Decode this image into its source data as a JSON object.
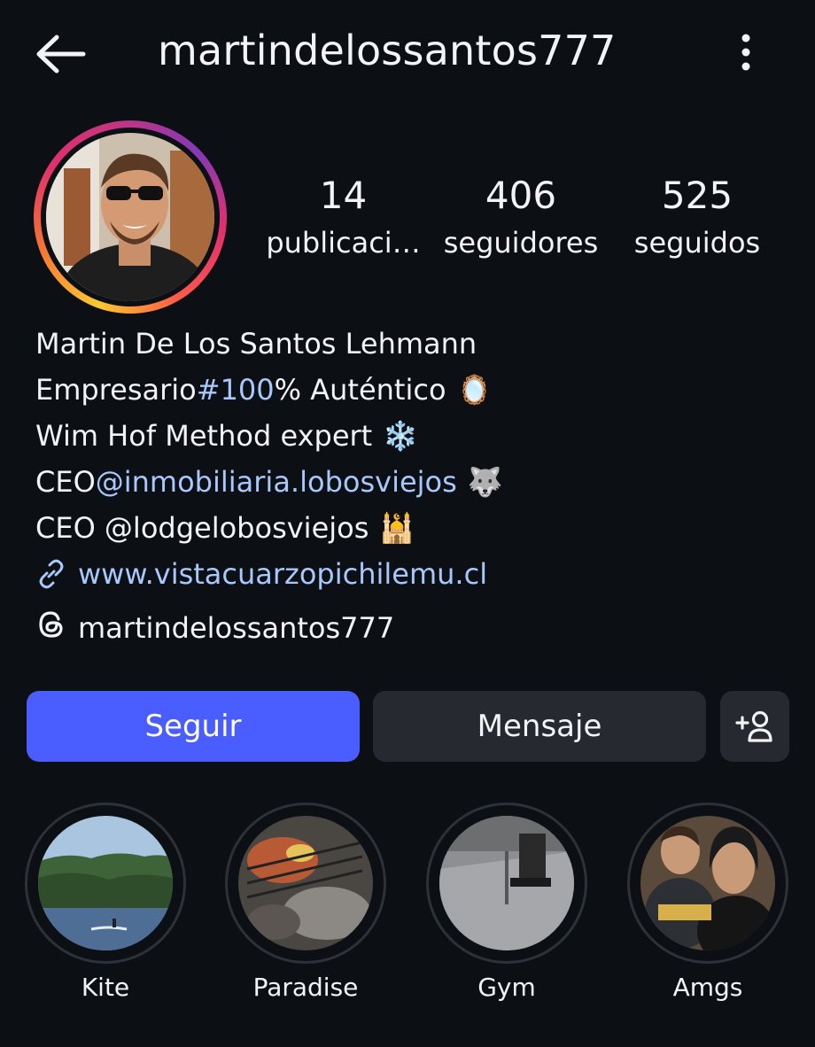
{
  "header": {
    "username": "martindelossantos777"
  },
  "stats": [
    {
      "value": "14",
      "label": "publicaci…"
    },
    {
      "value": "406",
      "label": "seguidores"
    },
    {
      "value": "525",
      "label": "seguidos"
    }
  ],
  "bio": {
    "name": "Martin De Los Santos Lehmann",
    "line1_text": "Empresario ",
    "line1_tag": "#100",
    "line1_rest": "% Auténtico",
    "line1_emoji": "🪞",
    "line2_text": "Wim Hof Method expert",
    "line2_emoji": "❄️",
    "line3_prefix": "CEO ",
    "line3_mention": "@inmobiliaria.lobosviejos",
    "line3_emoji": "🐺",
    "line4_text": "CEO @lodgelobosviejos",
    "line4_emoji": "🕌",
    "website": "www.vistacuarzopichilemu.cl"
  },
  "threads": {
    "handle": "martindelossantos777"
  },
  "actions": {
    "follow_label": "Seguir",
    "message_label": "Mensaje"
  },
  "highlights": [
    {
      "label": "Kite"
    },
    {
      "label": "Paradise"
    },
    {
      "label": "Gym"
    },
    {
      "label": "Amgs"
    }
  ],
  "colors": {
    "background": "#0c0f14",
    "follow_button": "#4a5dff",
    "secondary_button": "#26292f",
    "link": "#a8c7fa"
  }
}
